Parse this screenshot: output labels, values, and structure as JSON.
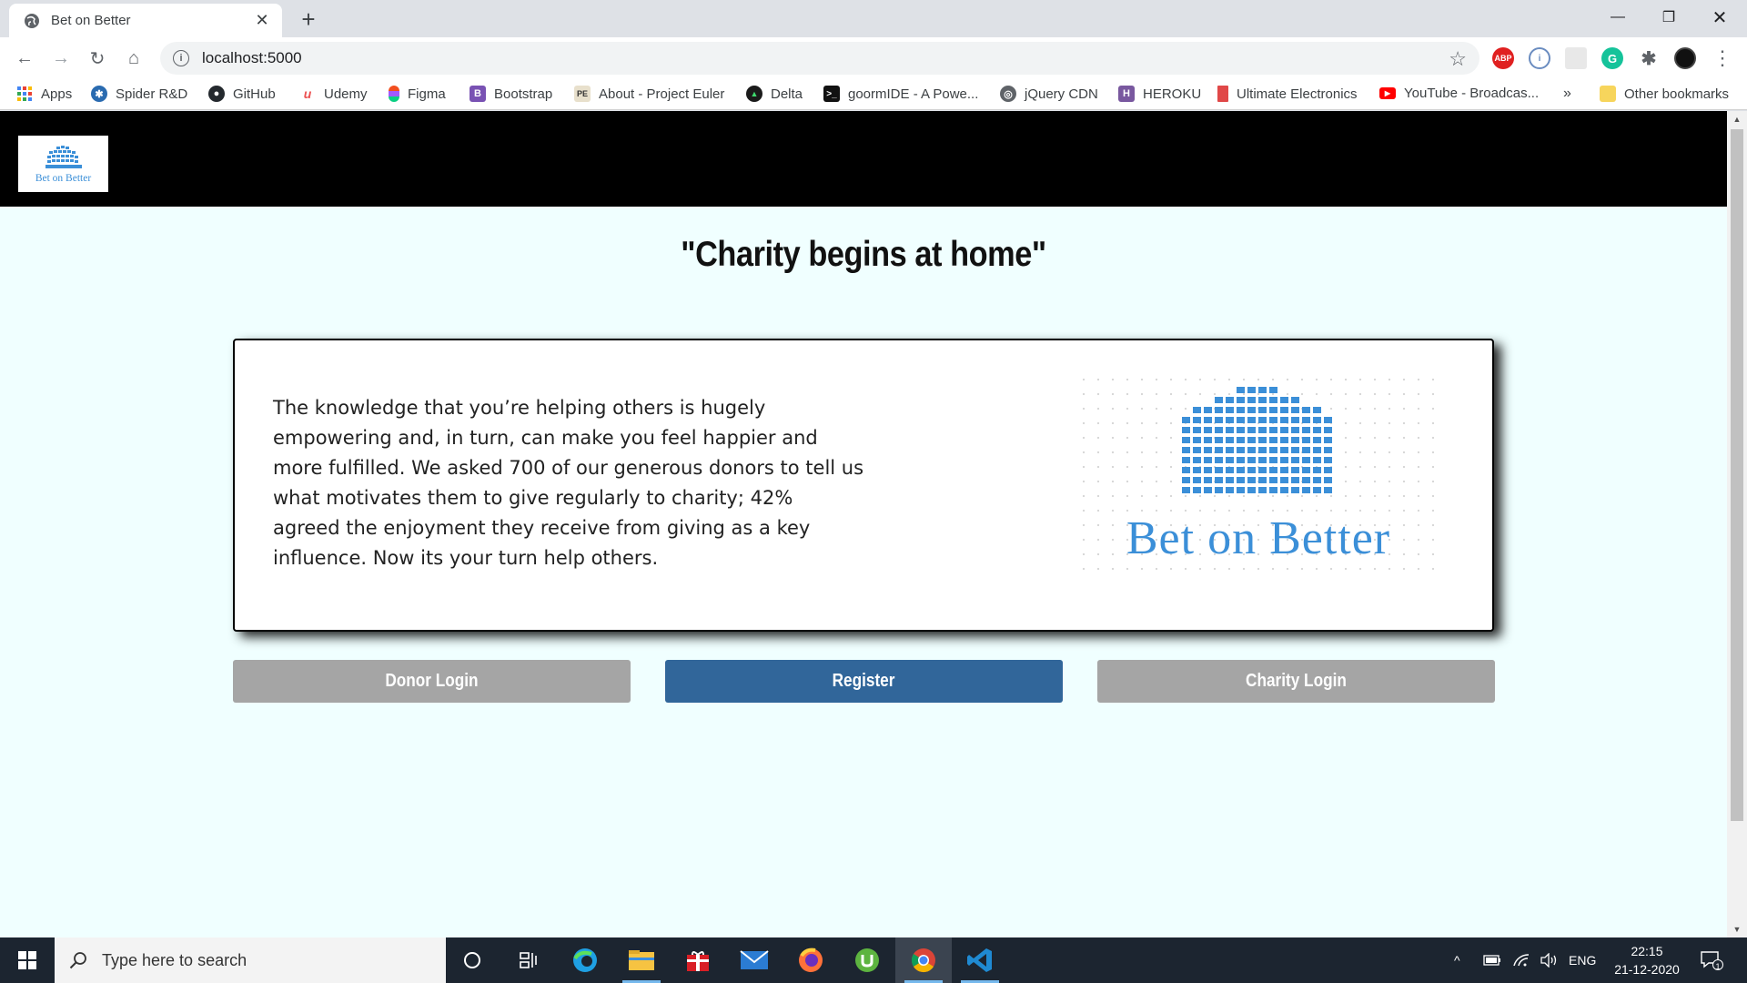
{
  "browser": {
    "tab_title": "Bet on Better",
    "tab_close": "✕",
    "new_tab": "+",
    "window_controls": {
      "minimize": "—",
      "maximize": "❐",
      "close": "✕"
    },
    "url": "localhost:5000",
    "bookmarks": [
      {
        "label": "Apps",
        "icon": "apps-grid-icon",
        "color": "#4285f4"
      },
      {
        "label": "Spider R&D",
        "icon": "spider-icon",
        "color": "#2a6bb0"
      },
      {
        "label": "GitHub",
        "icon": "github-icon",
        "color": "#24292e"
      },
      {
        "label": "Udemy",
        "icon": "udemy-icon",
        "color": "#ec5252"
      },
      {
        "label": "Figma",
        "icon": "figma-icon",
        "color": "#a259ff"
      },
      {
        "label": "Bootstrap",
        "icon": "bootstrap-icon",
        "color": "#7952b3"
      },
      {
        "label": "About - Project Euler",
        "icon": "project-euler-icon",
        "color": "#6b5b3e"
      },
      {
        "label": "Delta",
        "icon": "delta-icon",
        "color": "#1b1b1b"
      },
      {
        "label": "goormIDE - A Powe...",
        "icon": "terminal-icon",
        "color": "#111111"
      },
      {
        "label": "jQuery CDN",
        "icon": "globe-icon",
        "color": "#5f6368"
      },
      {
        "label": "HEROKU",
        "icon": "heroku-icon",
        "color": "#79589f"
      },
      {
        "label": "Ultimate Electronics",
        "icon": "bookmark-page-icon",
        "color": "#e04848"
      },
      {
        "label": "YouTube - Broadcas...",
        "icon": "youtube-icon",
        "color": "#ff0000"
      }
    ],
    "bookmarks_overflow": "»",
    "other_bookmarks": "Other bookmarks"
  },
  "site": {
    "logo_text": "Bet on Better",
    "quote": "\"Charity begins at home\"",
    "card_text": "The knowledge that you’re helping others is hugely empowering and, in turn, can make you feel happier and more fulfilled. We asked 700 of our generous donors to tell us what motivates them to give regularly to charity; 42% agreed the enjoyment they receive from giving as a key influence. Now its your turn help others.",
    "brand_text": "Bet on Better",
    "buttons": {
      "donor_login": "Donor Login",
      "register": "Register",
      "charity_login": "Charity Login"
    },
    "colors": {
      "navbar": "#000000",
      "background": "#f0ffff",
      "brand_blue": "#3b8fd8",
      "secondary_button": "#a5a5a5",
      "primary_button": "#31669a"
    }
  },
  "taskbar": {
    "search_placeholder": "Type here to search",
    "language": "ENG",
    "time": "22:15",
    "date": "21-12-2020",
    "notification_count": "1"
  }
}
